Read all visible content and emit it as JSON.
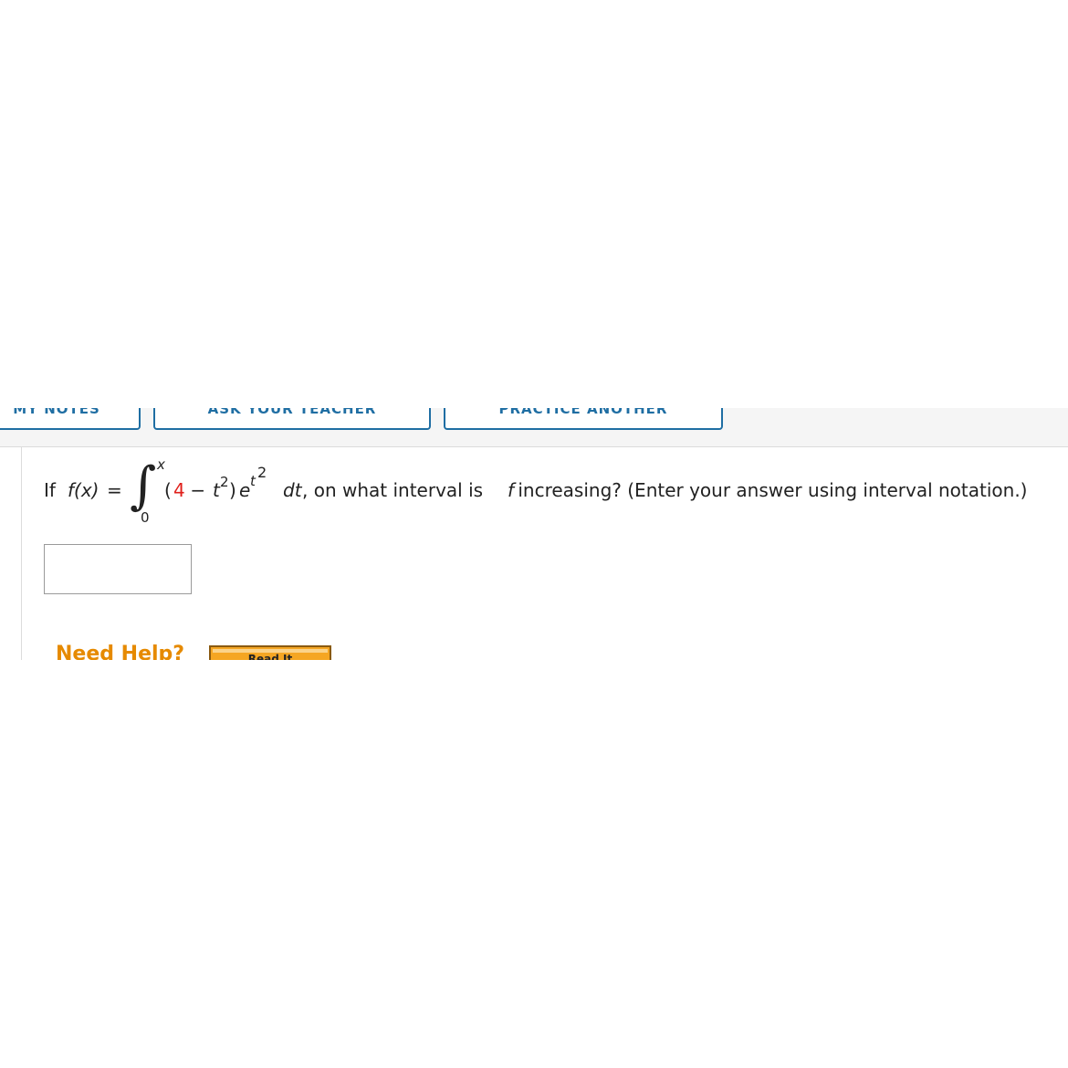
{
  "toolbar": {
    "buttons": [
      {
        "label": "MY NOTES"
      },
      {
        "label": "ASK YOUR TEACHER"
      },
      {
        "label": "PRACTICE ANOTHER"
      }
    ]
  },
  "question": {
    "prefix": "If",
    "function": "f(x)",
    "equals": "=",
    "integral_symbol": "∫",
    "upper_limit": "x",
    "lower_limit": "0",
    "open_paren": "(",
    "red_term": "4",
    "minus": " − ",
    "t": "t",
    "t_exponent": "2",
    "close_paren": ")",
    "e": "e",
    "e_exponent_base": "t",
    "e_exponent_power": "2",
    "dt": "dt",
    "question_text": ", on what interval is ",
    "f_symbol": "f",
    "question_rest": " increasing? (Enter your answer using interval notation.)"
  },
  "answer": {
    "value": "",
    "placeholder": ""
  },
  "help": {
    "label": "Need Help?",
    "read_it_label": "Read It"
  },
  "colors": {
    "accent": "#1f6ea3",
    "help": "#e68a00",
    "red_term": "#e0201b",
    "read_it_bg": "#f5a623"
  }
}
